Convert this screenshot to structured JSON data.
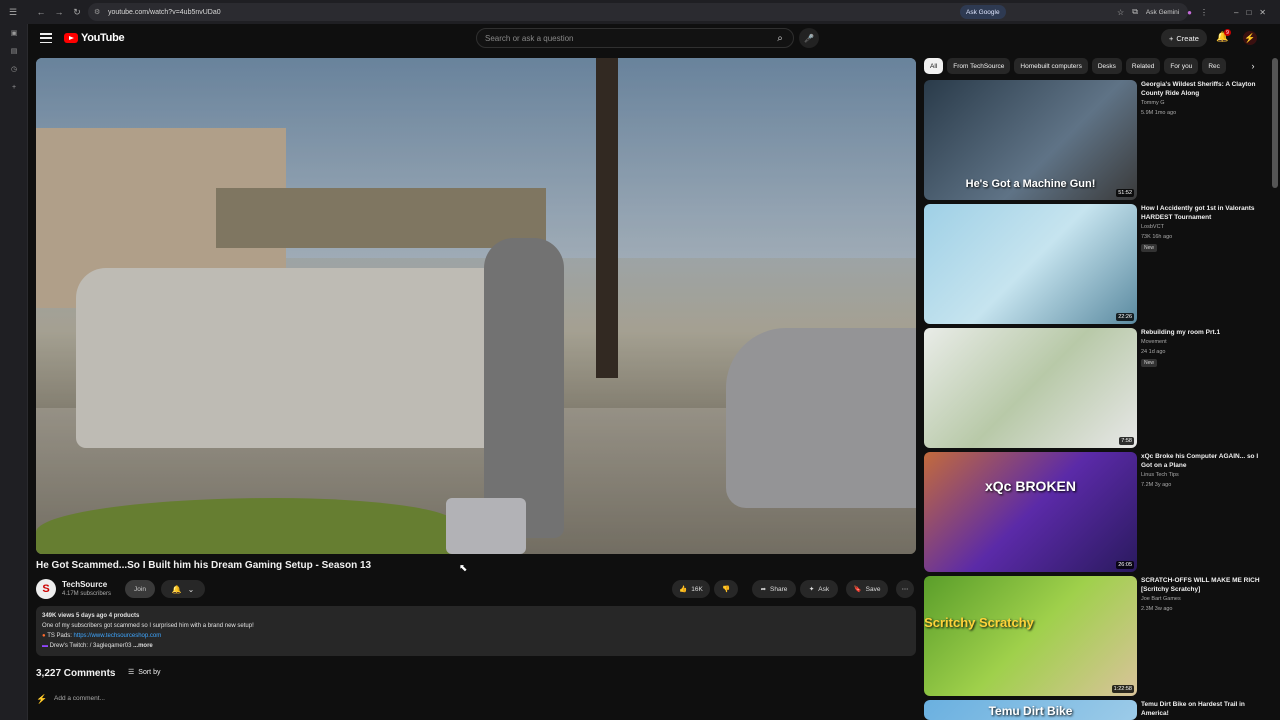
{
  "browser": {
    "url": "youtube.com/watch?v=4ub5nvUDa0",
    "ask_google": "Ask Google",
    "ask_gemini": "Ask Gemini"
  },
  "masthead": {
    "logo_text": "YouTube",
    "search_placeholder": "Search or ask a question",
    "create_label": "Create",
    "notification_count": "9"
  },
  "video": {
    "title": "He Got Scammed...So I Built him his Dream Gaming Setup - Season 13",
    "channel_name": "TechSource",
    "subscribers": "4.17M subscribers",
    "join_label": "Join",
    "likes": "16K",
    "share_label": "Share",
    "ask_label": "Ask",
    "save_label": "Save"
  },
  "description": {
    "meta": "349K views  5 days ago  4 products",
    "line1": "One of my subscribers got scammed so I surprised him with a brand new setup!",
    "line2_prefix": "TS Pads: ",
    "line2_link": "https://www.techsourceshop.com",
    "line3": "Drew's Twitch:  / 3agleqamer03",
    "more": "...more"
  },
  "comments": {
    "count_label": "3,227 Comments",
    "sort_label": "Sort by",
    "add_placeholder": "Add a comment..."
  },
  "chips": [
    "All",
    "From TechSource",
    "Homebuilt computers",
    "Desks",
    "Related",
    "For you",
    "Rec"
  ],
  "recommendations": [
    {
      "title": "Georgia's Wildest Sheriffs: A Clayton County Ride Along",
      "channel": "Tommy G",
      "meta": "5.9M  1mo ago",
      "duration": "51:52",
      "overlay": "He's Got a Machine Gun!",
      "is_new": ""
    },
    {
      "title": "How I Accidently got 1st in Valorants HARDEST Tournament",
      "channel": "LosbVCT",
      "meta": "73K  16h ago",
      "duration": "22:26",
      "overlay": "",
      "is_new": "New"
    },
    {
      "title": "Rebuilding my room Prt.1",
      "channel": "Movement",
      "meta": "24  1d ago",
      "duration": "7:58",
      "overlay": "",
      "is_new": "New"
    },
    {
      "title": "xQc Broke his Computer AGAIN... so I Got on a Plane",
      "channel": "Linus Tech Tips",
      "meta": "7.2M  3y ago",
      "duration": "26:05",
      "overlay": "xQc BROKEN",
      "is_new": ""
    },
    {
      "title": "SCRATCH-OFFS WILL MAKE ME RICH [Scritchy Scratchy]",
      "channel": "Joe Bart Games",
      "meta": "2.3M  3w ago",
      "duration": "1:22:58",
      "overlay": "Scritchy Scratchy",
      "is_new": ""
    },
    {
      "title": "Temu Dirt Bike on Hardest Trail in America!",
      "channel": "",
      "meta": "",
      "duration": "",
      "overlay": "Temu Dirt Bike",
      "is_new": ""
    }
  ],
  "colors": {
    "brand": "#ff0000",
    "link": "#3ea6ff",
    "background": "#0f0f0f"
  }
}
